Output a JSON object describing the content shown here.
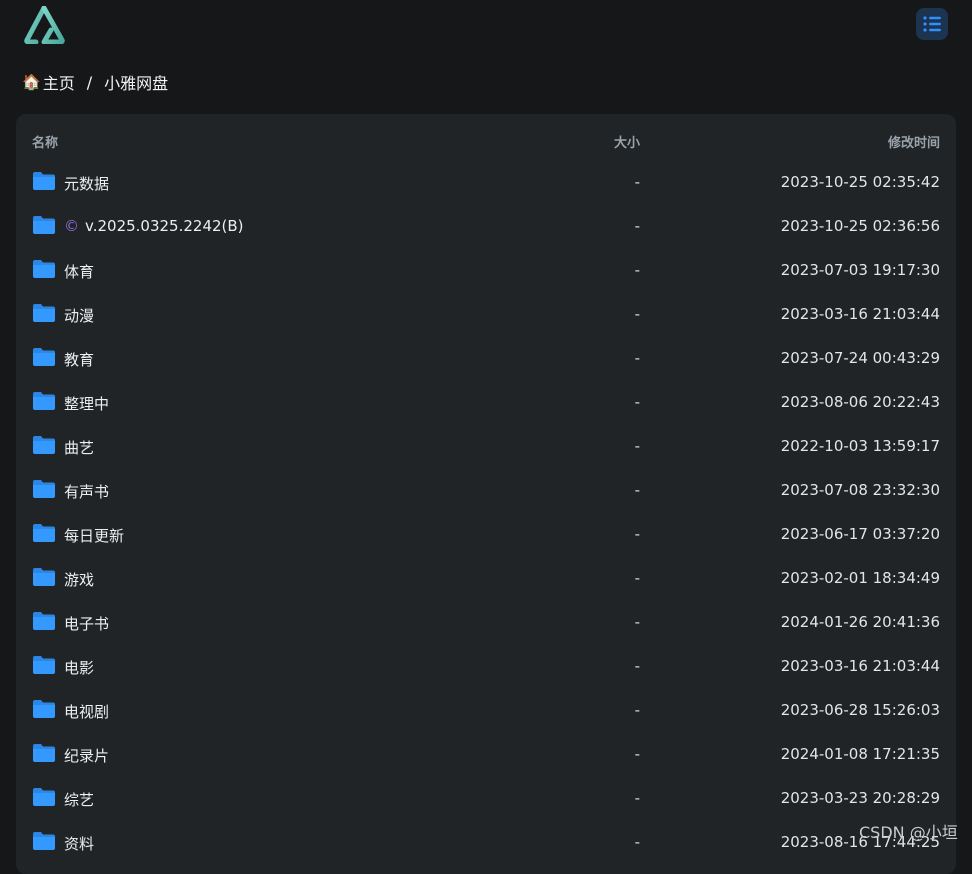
{
  "header": {
    "logo_icon": "alist-logo-icon",
    "menu_icon": "list-menu-icon",
    "accent": "#1e90ff"
  },
  "breadcrumb": {
    "home_icon": "🏠",
    "home_label": "主页",
    "separator": "/",
    "current": "小雅网盘"
  },
  "table": {
    "headers": {
      "name": "名称",
      "size": "大小",
      "modified": "修改时间"
    },
    "rows": [
      {
        "name": "元数据",
        "size": "-",
        "modified": "2023-10-25 02:35:42"
      },
      {
        "symbol": "©",
        "name": "v.2025.0325.2242(B)",
        "size": "-",
        "modified": "2023-10-25 02:36:56"
      },
      {
        "name": "体育",
        "size": "-",
        "modified": "2023-07-03 19:17:30"
      },
      {
        "name": "动漫",
        "size": "-",
        "modified": "2023-03-16 21:03:44"
      },
      {
        "name": "教育",
        "size": "-",
        "modified": "2023-07-24 00:43:29"
      },
      {
        "name": "整理中",
        "size": "-",
        "modified": "2023-08-06 20:22:43"
      },
      {
        "name": "曲艺",
        "size": "-",
        "modified": "2022-10-03 13:59:17"
      },
      {
        "name": "有声书",
        "size": "-",
        "modified": "2023-07-08 23:32:30"
      },
      {
        "name": "每日更新",
        "size": "-",
        "modified": "2023-06-17 03:37:20"
      },
      {
        "name": "游戏",
        "size": "-",
        "modified": "2023-02-01 18:34:49"
      },
      {
        "name": "电子书",
        "size": "-",
        "modified": "2024-01-26 20:41:36"
      },
      {
        "name": "电影",
        "size": "-",
        "modified": "2023-03-16 21:03:44"
      },
      {
        "name": "电视剧",
        "size": "-",
        "modified": "2023-06-28 15:26:03"
      },
      {
        "name": "纪录片",
        "size": "-",
        "modified": "2024-01-08 17:21:35"
      },
      {
        "name": "综艺",
        "size": "-",
        "modified": "2023-03-23 20:28:29"
      },
      {
        "name": "资料",
        "size": "-",
        "modified": "2023-08-16 17:44:25"
      }
    ]
  },
  "watermark": "CSDN @小垣"
}
